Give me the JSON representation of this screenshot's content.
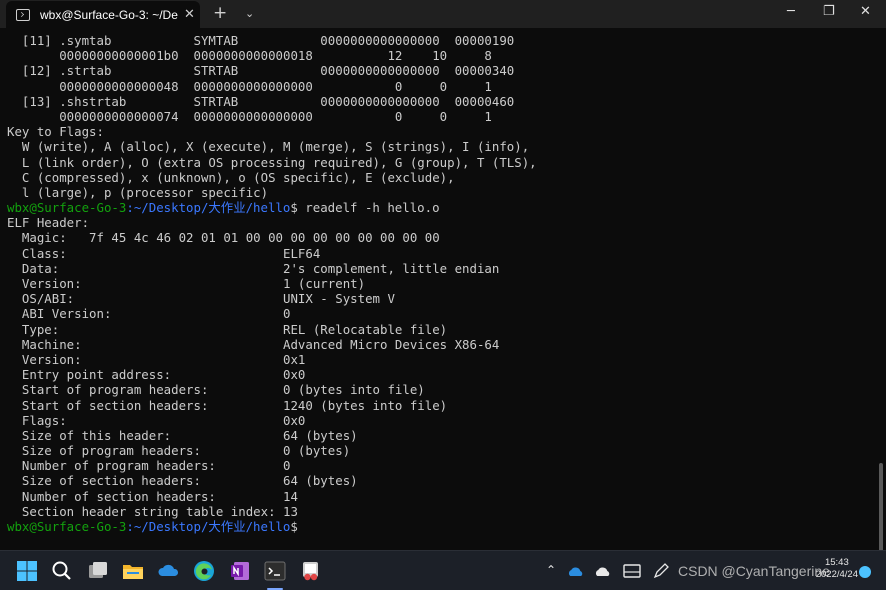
{
  "window": {
    "tab_title": "wbx@Surface-Go-3: ~/De",
    "tab_close": "✕",
    "new_tab": "+",
    "tab_dropdown": "⌄",
    "minimize": "─",
    "maximize": "❐",
    "close": "✕"
  },
  "terminal": {
    "prompt_user": "wbx@Surface-Go-3",
    "prompt_path": ":~/Desktop/大作业/hello",
    "command": "$ readelf -h hello.o",
    "prompt_end": "$",
    "lines": [
      "  [11] .symtab           SYMTAB           0000000000000000  00000190",
      "       00000000000001b0  0000000000000018          12    10     8",
      "  [12] .strtab           STRTAB           0000000000000000  00000340",
      "       0000000000000048  0000000000000000           0     0     1",
      "  [13] .shstrtab         STRTAB           0000000000000000  00000460",
      "       0000000000000074  0000000000000000           0     0     1",
      "Key to Flags:",
      "  W (write), A (alloc), X (execute), M (merge), S (strings), I (info),",
      "  L (link order), O (extra OS processing required), G (group), T (TLS),",
      "  C (compressed), x (unknown), o (OS specific), E (exclude),",
      "  l (large), p (processor specific)"
    ],
    "header_lines": [
      "ELF Header:",
      "  Magic:   7f 45 4c 46 02 01 01 00 00 00 00 00 00 00 00 00",
      "  Class:                             ELF64",
      "  Data:                              2's complement, little endian",
      "  Version:                           1 (current)",
      "  OS/ABI:                            UNIX - System V",
      "  ABI Version:                       0",
      "  Type:                              REL (Relocatable file)",
      "  Machine:                           Advanced Micro Devices X86-64",
      "  Version:                           0x1",
      "  Entry point address:               0x0",
      "  Start of program headers:          0 (bytes into file)",
      "  Start of section headers:          1240 (bytes into file)",
      "  Flags:                             0x0",
      "  Size of this header:               64 (bytes)",
      "  Size of program headers:           0 (bytes)",
      "  Number of program headers:         0",
      "  Size of section headers:           64 (bytes)",
      "  Number of section headers:         14",
      "  Section header string table index: 13"
    ]
  },
  "taskbar": {
    "tray_up_arrow": "⌃",
    "time": "15:43",
    "date": "2022/4/24",
    "watermark": "CSDN @CyanTangerine"
  },
  "colors": {
    "prompt_user": "#13a10e",
    "prompt_path": "#3b78ff",
    "text": "#cccccc",
    "background": "#0c0c0c"
  }
}
